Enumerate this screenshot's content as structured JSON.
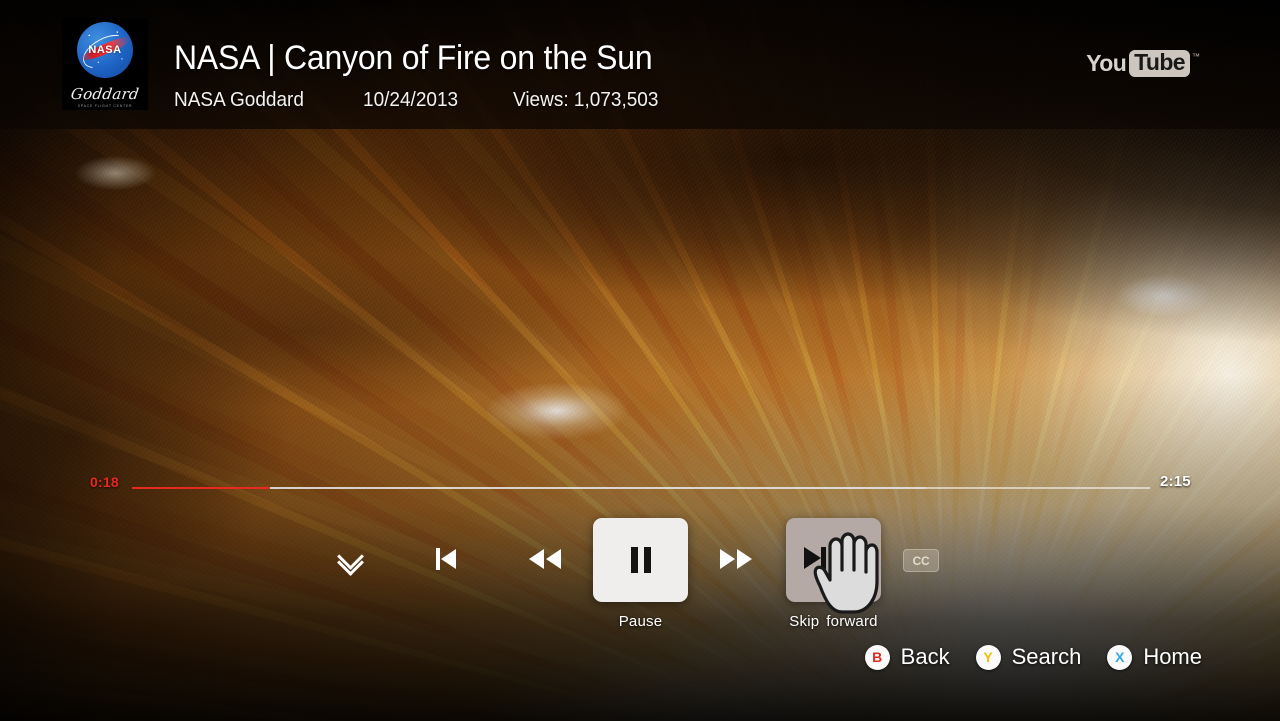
{
  "header": {
    "logo": {
      "agency": "NASA",
      "center": "Goddard",
      "center_sub": "SPACE FLIGHT CENTER"
    },
    "title": "NASA | Canyon of Fire on the Sun",
    "channel": "NASA Goddard",
    "date": "10/24/2013",
    "views": "Views: 1,073,503",
    "brand": {
      "part1": "You",
      "part2": "Tube",
      "tm": "™"
    }
  },
  "player": {
    "current_time": "0:18",
    "total_time": "2:15",
    "played_percent": 13.6,
    "buffered_percent": 78,
    "colors": {
      "played": "#e8291f",
      "track": "#ffffff",
      "focus_button": "#b4a9a5",
      "active_button": "#efeeec"
    },
    "controls": [
      {
        "name": "collapse",
        "icon": "chevron-double-down-icon",
        "label": ""
      },
      {
        "name": "previous",
        "icon": "skip-to-start-icon",
        "label": ""
      },
      {
        "name": "rewind",
        "icon": "rewind-icon",
        "label": ""
      },
      {
        "name": "pause",
        "icon": "pause-icon",
        "label": "Pause"
      },
      {
        "name": "fast-forward",
        "icon": "fast-forward-icon",
        "label": ""
      },
      {
        "name": "skip-forward",
        "icon": "skip-forward-icon",
        "label": "Skip forward"
      },
      {
        "name": "closed-captions",
        "icon": "cc-icon",
        "label": "CC"
      }
    ],
    "cc_label": "CC",
    "pause_label": "Pause",
    "skip_label_a": "Skip",
    "skip_label_b": "forward"
  },
  "hints": [
    {
      "key": "B",
      "label": "Back",
      "color": "#e02b20"
    },
    {
      "key": "Y",
      "label": "Search",
      "color": "#f2c009"
    },
    {
      "key": "X",
      "label": "Home",
      "color": "#2fa8e8"
    }
  ]
}
